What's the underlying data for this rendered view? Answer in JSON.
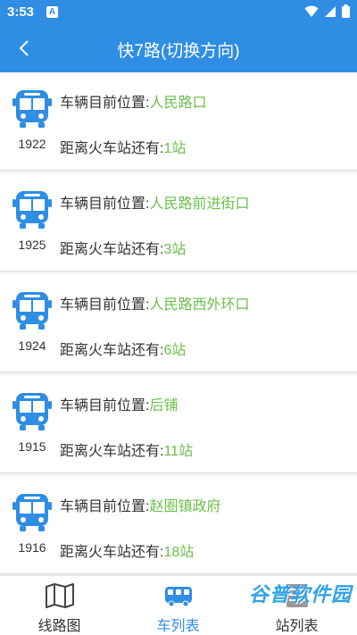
{
  "status_bar": {
    "time": "3:53",
    "app_badge": "A"
  },
  "header": {
    "title": "快7路(切换方向)"
  },
  "labels": {
    "location_prefix": "车辆目前位置:",
    "distance_prefix": "距离火车站还有:"
  },
  "buses": [
    {
      "number": "1922",
      "location": "人民路口",
      "distance": "1站"
    },
    {
      "number": "1925",
      "location": "人民路前进街口",
      "distance": "3站"
    },
    {
      "number": "1924",
      "location": "人民路西外环口",
      "distance": "6站"
    },
    {
      "number": "1915",
      "location": "后铺",
      "distance": "11站"
    },
    {
      "number": "1916",
      "location": "赵圈镇政府",
      "distance": "18站"
    }
  ],
  "tabs": [
    {
      "label": "线路图",
      "icon": "map-icon",
      "active": false
    },
    {
      "label": "车列表",
      "icon": "bus-icon",
      "active": true
    },
    {
      "label": "站列表",
      "icon": "list-icon",
      "active": false
    }
  ],
  "watermark": "谷普软件园",
  "colors": {
    "primary": "#2f8de4",
    "highlight": "#6bbf49"
  }
}
